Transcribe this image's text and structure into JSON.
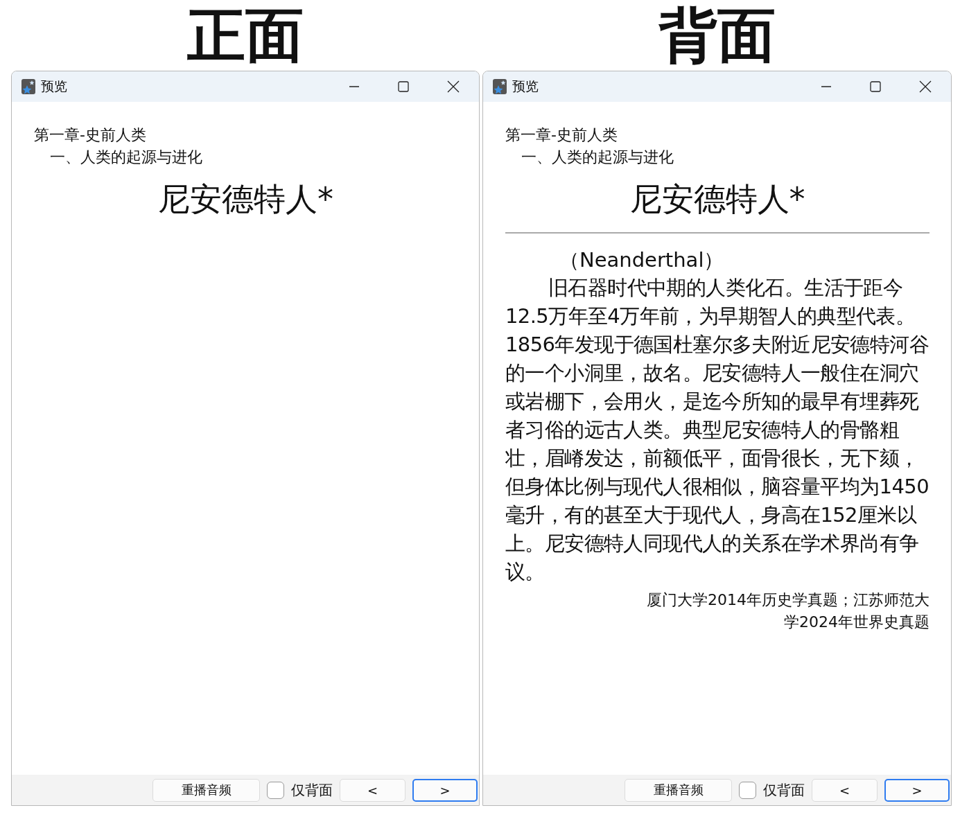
{
  "panels": [
    {
      "heading": "正面",
      "window": {
        "title": "预览",
        "deck": "第一章-史前人类",
        "section": "一、人类的起源与进化",
        "card_title": "尼安德特人*",
        "footer": {
          "replay_button": "重播音频",
          "back_only": {
            "label": "仅背面",
            "checked": false
          },
          "prev_button": {
            "label": "<",
            "focused": false
          },
          "next_button": {
            "label": ">",
            "focused": true
          }
        }
      }
    },
    {
      "heading": "背面",
      "window": {
        "title": "预览",
        "deck": "第一章-史前人类",
        "section": "一、人类的起源与进化",
        "card_title": "尼安德特人*",
        "answer": {
          "alias": "（Neanderthal）",
          "body": "旧石器时代中期的人类化石。生活于距今12.5万年至4万年前，为早期智人的典型代表。1856年发现于德国杜塞尔多夫附近尼安德特河谷的一个小洞里，故名。尼安德特人一般住在洞穴或岩棚下，会用火，是迄今所知的最早有埋葬死者习俗的远古人类。典型尼安德特人的骨骼粗壮，眉嵴发达，前额低平，面骨很长，无下颏，但身体比例与现代人很相似，脑容量平均为1450毫升，有的甚至大于现代人，身高在152厘米以上。尼安德特人同现代人的关系在学术界尚有争议。",
          "source": "厦门大学2014年历史学真题；江苏师范大学2024年世界史真题"
        },
        "footer": {
          "replay_button": "重播音频",
          "back_only": {
            "label": "仅背面",
            "checked": false
          },
          "prev_button": {
            "label": "<",
            "focused": false
          },
          "next_button": {
            "label": ">",
            "focused": true
          }
        }
      }
    }
  ]
}
